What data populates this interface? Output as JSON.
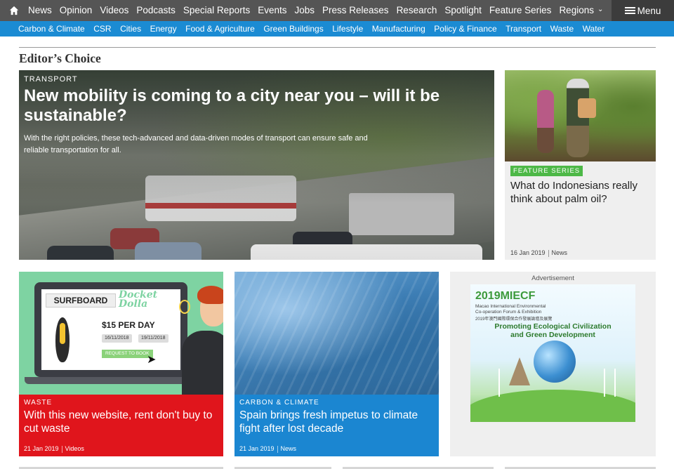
{
  "topnav": {
    "items": [
      "News",
      "Opinion",
      "Videos",
      "Podcasts",
      "Special Reports",
      "Events",
      "Jobs",
      "Press Releases",
      "Research",
      "Spotlight",
      "Feature Series",
      "Regions"
    ],
    "menu_label": "Menu"
  },
  "subnav": {
    "items": [
      "Carbon & Climate",
      "CSR",
      "Cities",
      "Energy",
      "Food & Agriculture",
      "Green Buildings",
      "Lifestyle",
      "Manufacturing",
      "Policy & Finance",
      "Transport",
      "Waste",
      "Water"
    ]
  },
  "section": {
    "title": "Editor’s Choice"
  },
  "hero": {
    "kicker": "TRANSPORT",
    "headline": "New mobility is coming to a city near you – will it be sustainable?",
    "standfirst": "With the right policies, these tech-advanced and data-driven modes of transport can ensure safe and reliable transportation for all."
  },
  "side_card": {
    "badge": "FEATURE SERIES",
    "title": "What do Indonesians really think about palm oil?",
    "date": "16 Jan 2019",
    "type": "News",
    "badge_color": "#4db847"
  },
  "cards": [
    {
      "kicker": "WASTE",
      "title": "With this new website, rent don't buy to cut waste",
      "date": "21 Jan 2019",
      "type": "Videos",
      "color": "#e0151c",
      "illustration": {
        "surf_label": "SURFBOARD",
        "brand": "Docket Dolla",
        "price": "$15 PER DAY",
        "date_from": "16/11/2018",
        "date_to": "19/11/2018",
        "button": "REQUEST TO BOOK"
      }
    },
    {
      "kicker": "CARBON & CLIMATE",
      "title": "Spain brings fresh impetus to climate fight after lost decade",
      "date": "21 Jan 2019",
      "type": "News",
      "color": "#1b86d1"
    }
  ],
  "ad": {
    "label": "Advertisement",
    "poster_title": "2019MIECF",
    "poster_sub1": "Macao International Environmental",
    "poster_sub2": "Co-operation Forum & Exhibition",
    "poster_sub3": "2019年澳門國際環保合作發展論壇及展覽",
    "poster_tag1": "Promoting Ecological Civilization",
    "poster_tag2": "and Green Development"
  },
  "colors": {
    "topnav_bg": "#555555",
    "subnav_bg": "#1b8bd3",
    "accent_red": "#e0151c",
    "accent_blue": "#1b86d1"
  },
  "icons": {
    "home": "home-icon",
    "regions_chevron": "chevron-down-icon",
    "menu": "hamburger-icon"
  }
}
